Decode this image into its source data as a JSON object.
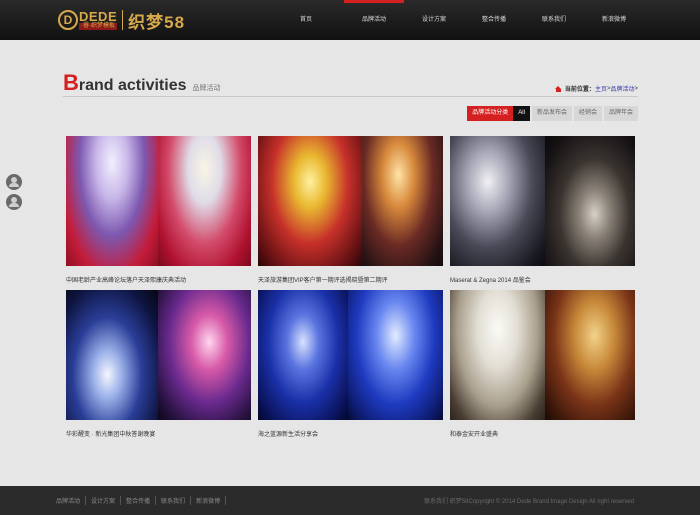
{
  "header": {
    "logo": {
      "mark": "D",
      "brand": "DEDE",
      "sub": "·睿·织梦模板",
      "cn": "织梦58"
    },
    "nav": [
      {
        "label": "首页"
      },
      {
        "label": "品牌活动",
        "active": true
      },
      {
        "label": "设计方案"
      },
      {
        "label": "整合传播"
      },
      {
        "label": "联系我们"
      },
      {
        "label": "新浪微博"
      }
    ]
  },
  "page": {
    "title_first": "B",
    "title_rest": "rand activities",
    "title_cn": "品牌活动",
    "breadcrumb": {
      "label": "当前位置：",
      "home": "主页",
      "sep": " > ",
      "current": "品牌活动",
      "tail": " >"
    }
  },
  "filter": {
    "label": "品牌活动分类",
    "all": "All",
    "items": [
      "新品发布会",
      "经销会",
      "品牌年会"
    ]
  },
  "cards": [
    {
      "caption": "中国老龄产业高峰论坛落户天泽熙康庆典活动"
    },
    {
      "caption": "天泽旅游集团VIP客户第一期评选揭晓暨第二期评"
    },
    {
      "caption": "Maserat & Zegna 2014 品鉴会"
    },
    {
      "caption": "华彩醒变 · 新光集团中秋答谢晚宴"
    },
    {
      "caption": "海之蓝源新生活分享会"
    },
    {
      "caption": "和泰金安开业盛典"
    }
  ],
  "footer": {
    "links": [
      "品牌活动",
      "设计方案",
      "整合传播",
      "联系我们",
      "新浪微博"
    ],
    "copyright": "联系我们 织梦58Copyright © 2014 Dede Brand Image Design All right reserved"
  },
  "colors": {
    "accent": "#d42020",
    "header_bg": "#1a1a1a",
    "page_bg": "#e6e6e6",
    "footer_bg": "#2b2b2b"
  }
}
